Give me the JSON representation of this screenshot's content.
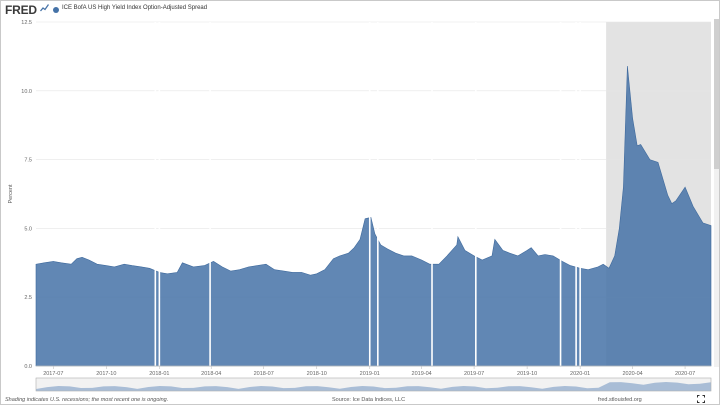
{
  "header": {
    "logo_text": "FRED",
    "series_label": "ICE BofA US High Yield Index Option-Adjusted Spread",
    "series_color": "#4572a7"
  },
  "chart_data": {
    "type": "area",
    "title": "",
    "xlabel": "",
    "ylabel": "Percent",
    "ylim": [
      0,
      12.5
    ],
    "yticks": [
      "0.0",
      "2.5",
      "5.0",
      "7.5",
      "10.0",
      "12.5"
    ],
    "xticks": [
      "2017-07",
      "2017-10",
      "2018-01",
      "2018-04",
      "2018-07",
      "2018-10",
      "2019-01",
      "2019-04",
      "2019-07",
      "2019-10",
      "2020-01",
      "2020-04",
      "2020-07"
    ],
    "xlim": [
      "2017-06-01",
      "2020-08-15"
    ],
    "grid": true,
    "series_color": "#4572a7",
    "recession_shading": [
      [
        "2020-02-15",
        "2020-08-15"
      ]
    ],
    "gap_markers": [
      "2017-12-25",
      "2018-01-01",
      "2018-03-30",
      "2019-01-01",
      "2019-01-15",
      "2019-04-19",
      "2019-07-04",
      "2019-11-28",
      "2019-12-25",
      "2020-01-01"
    ],
    "series": [
      {
        "name": "ICE BofA US High Yield Index Option-Adjusted Spread",
        "x": [
          "2017-06-01",
          "2017-06-15",
          "2017-07-01",
          "2017-07-15",
          "2017-08-01",
          "2017-08-11",
          "2017-08-20",
          "2017-09-01",
          "2017-09-15",
          "2017-10-01",
          "2017-10-15",
          "2017-11-01",
          "2017-11-15",
          "2017-12-01",
          "2017-12-15",
          "2018-01-01",
          "2018-01-15",
          "2018-02-01",
          "2018-02-10",
          "2018-03-01",
          "2018-03-20",
          "2018-04-05",
          "2018-04-20",
          "2018-05-05",
          "2018-05-20",
          "2018-06-05",
          "2018-06-20",
          "2018-07-05",
          "2018-07-20",
          "2018-08-05",
          "2018-08-20",
          "2018-09-05",
          "2018-09-20",
          "2018-10-01",
          "2018-10-15",
          "2018-10-30",
          "2018-11-10",
          "2018-11-25",
          "2018-12-05",
          "2018-12-15",
          "2018-12-24",
          "2019-01-03",
          "2019-01-10",
          "2019-01-20",
          "2019-02-01",
          "2019-02-15",
          "2019-03-01",
          "2019-03-15",
          "2019-04-01",
          "2019-04-15",
          "2019-05-01",
          "2019-05-15",
          "2019-06-01",
          "2019-06-03",
          "2019-06-15",
          "2019-07-01",
          "2019-07-15",
          "2019-08-01",
          "2019-08-06",
          "2019-08-20",
          "2019-09-01",
          "2019-09-15",
          "2019-10-01",
          "2019-10-08",
          "2019-10-20",
          "2019-11-01",
          "2019-11-15",
          "2019-12-01",
          "2019-12-15",
          "2020-01-01",
          "2020-01-15",
          "2020-02-01",
          "2020-02-10",
          "2020-02-20",
          "2020-03-01",
          "2020-03-09",
          "2020-03-16",
          "2020-03-23",
          "2020-04-01",
          "2020-04-09",
          "2020-04-15",
          "2020-05-01",
          "2020-05-15",
          "2020-06-01",
          "2020-06-08",
          "2020-06-15",
          "2020-07-01",
          "2020-07-15",
          "2020-08-01",
          "2020-08-15"
        ],
        "values": [
          3.7,
          3.75,
          3.8,
          3.75,
          3.7,
          3.9,
          3.95,
          3.85,
          3.7,
          3.65,
          3.6,
          3.7,
          3.65,
          3.6,
          3.55,
          3.4,
          3.35,
          3.4,
          3.75,
          3.6,
          3.65,
          3.8,
          3.6,
          3.45,
          3.5,
          3.6,
          3.65,
          3.7,
          3.5,
          3.45,
          3.4,
          3.4,
          3.3,
          3.35,
          3.5,
          3.9,
          4.0,
          4.1,
          4.3,
          4.6,
          5.35,
          5.4,
          4.8,
          4.4,
          4.25,
          4.1,
          4.0,
          4.0,
          3.85,
          3.7,
          3.7,
          4.0,
          4.4,
          4.7,
          4.2,
          4.0,
          3.85,
          4.0,
          4.6,
          4.2,
          4.1,
          4.0,
          4.2,
          4.3,
          4.0,
          4.05,
          4.0,
          3.8,
          3.65,
          3.55,
          3.5,
          3.6,
          3.7,
          3.55,
          4.0,
          5.0,
          6.5,
          10.9,
          9.0,
          8.0,
          8.05,
          7.5,
          7.4,
          6.2,
          5.9,
          6.0,
          6.5,
          5.8,
          5.2,
          5.1
        ]
      }
    ]
  },
  "footer": {
    "note": "Shading indicates U.S. recessions; the most recent one is ongoing.",
    "source": "Source: Ice Data Indices, LLC",
    "url": "fred.stlouisfed.org"
  }
}
